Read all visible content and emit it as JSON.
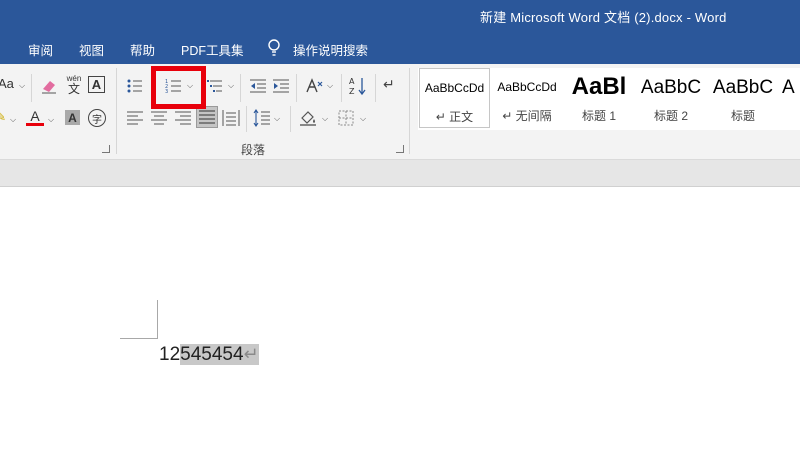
{
  "window": {
    "title": "新建 Microsoft Word 文档 (2).docx  -  Word"
  },
  "tabs": [
    "审阅",
    "视图",
    "帮助",
    "PDF工具集"
  ],
  "tell_me": {
    "label": "操作说明搜索"
  },
  "font_group": {
    "change_case": "Aa",
    "phonetic_top": "wén",
    "phonetic_bottom": "文",
    "font_color_glyph": "A",
    "shade_glyph": "A",
    "enclose_glyph": "字",
    "char_border_glyph": "A"
  },
  "paragraph_group": {
    "label": "段落"
  },
  "styles_gallery": {
    "items": [
      {
        "sample": "AaBbCcDd",
        "name": "↵ 正文",
        "selected": true
      },
      {
        "sample": "AaBbCcDd",
        "name": "↵ 无间隔",
        "selected": false
      },
      {
        "sample": "AaBl",
        "name": "标题 1",
        "selected": false
      },
      {
        "sample": "AaBbC",
        "name": "标题 2",
        "selected": false
      },
      {
        "sample": "AaBbC",
        "name": "标题",
        "selected": false
      },
      {
        "sample": "A",
        "name": "",
        "selected": false
      }
    ]
  },
  "document": {
    "text_plain": "12",
    "text_selected": "545454",
    "para_mark": "↵"
  },
  "colors": {
    "title_bar": "#2b579a",
    "highlight": "#e8000b",
    "font_color_bar": "#e8000b"
  }
}
